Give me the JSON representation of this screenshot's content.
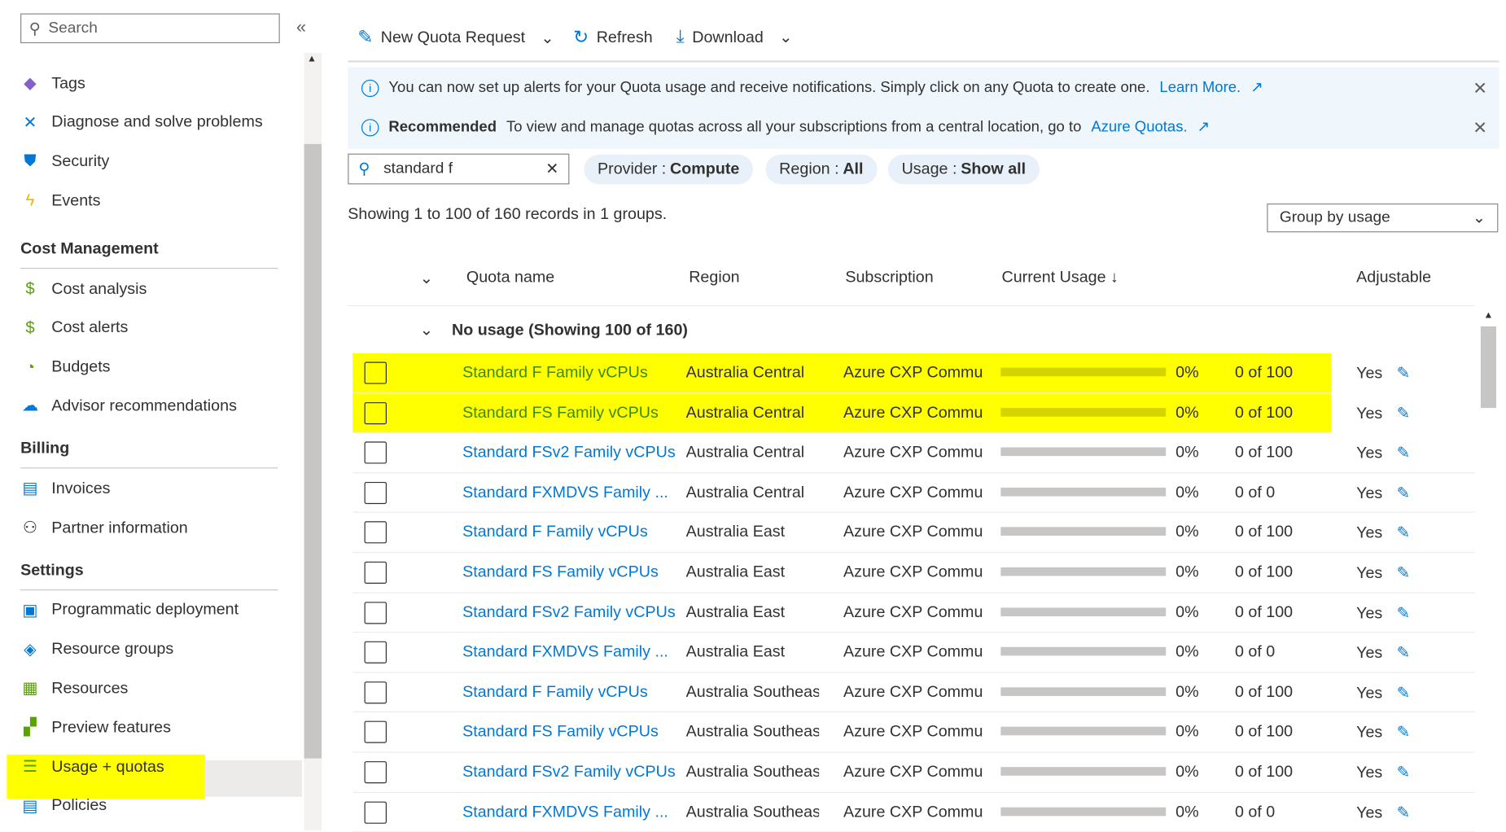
{
  "sidebar": {
    "search_placeholder": "Search",
    "items": [
      {
        "label": "Tags",
        "icon": "tag-icon",
        "color": "#8661c5"
      },
      {
        "label": "Diagnose and solve problems",
        "icon": "wrench-icon",
        "color": "#0078d4"
      },
      {
        "label": "Security",
        "icon": "shield-icon",
        "color": "#0078d4"
      },
      {
        "label": "Events",
        "icon": "lightning-icon",
        "color": "#f8d22a"
      }
    ],
    "sections": [
      {
        "title": "Cost Management",
        "items": [
          {
            "label": "Cost analysis",
            "icon": "cost-analysis-icon"
          },
          {
            "label": "Cost alerts",
            "icon": "cost-alerts-icon"
          },
          {
            "label": "Budgets",
            "icon": "budgets-icon"
          },
          {
            "label": "Advisor recommendations",
            "icon": "advisor-icon"
          }
        ]
      },
      {
        "title": "Billing",
        "items": [
          {
            "label": "Invoices",
            "icon": "invoice-icon"
          },
          {
            "label": "Partner information",
            "icon": "partner-icon"
          }
        ]
      },
      {
        "title": "Settings",
        "items": [
          {
            "label": "Programmatic deployment",
            "icon": "deployment-icon"
          },
          {
            "label": "Resource groups",
            "icon": "resource-groups-icon"
          },
          {
            "label": "Resources",
            "icon": "resources-icon"
          },
          {
            "label": "Preview features",
            "icon": "preview-icon"
          },
          {
            "label": "Usage + quotas",
            "icon": "usage-quotas-icon",
            "selected": true
          },
          {
            "label": "Policies",
            "icon": "policies-icon"
          }
        ]
      }
    ]
  },
  "toolbar": {
    "new_quota": "New Quota Request",
    "refresh": "Refresh",
    "download": "Download"
  },
  "banners": [
    {
      "text": "You can now set up alerts for your Quota usage and receive notifications. Simply click on any Quota to create one.",
      "link": "Learn More."
    },
    {
      "bold": "Recommended",
      "text": "To view and manage quotas across all your subscriptions from a central location, go to",
      "link": "Azure Quotas."
    }
  ],
  "filter": {
    "search_value": "standard f",
    "pills": [
      {
        "label": "Provider :",
        "value": "Compute"
      },
      {
        "label": "Region :",
        "value": "All"
      },
      {
        "label": "Usage :",
        "value": "Show all"
      }
    ]
  },
  "summary": "Showing 1 to 100 of 160 records in 1 groups.",
  "group_by": "Group by usage",
  "columns": [
    "Quota name",
    "Region",
    "Subscription",
    "Current Usage ↓",
    "Adjustable"
  ],
  "group_label": "No usage (Showing 100 of 160)",
  "colors": {
    "highlight": "#ffff00",
    "link": "#0078d4",
    "bar": "#c8c6c4"
  },
  "rows": [
    {
      "name": "Standard F Family vCPUs",
      "region": "Australia Central",
      "sub": "Azure CXP Commu",
      "pct": "0%",
      "usage": "0 of 100",
      "adj": "Yes",
      "highlight": true
    },
    {
      "name": "Standard FS Family vCPUs",
      "region": "Australia Central",
      "sub": "Azure CXP Commu",
      "pct": "0%",
      "usage": "0 of 100",
      "adj": "Yes",
      "highlight": true
    },
    {
      "name": "Standard FSv2 Family vCPUs",
      "region": "Australia Central",
      "sub": "Azure CXP Commu",
      "pct": "0%",
      "usage": "0 of 100",
      "adj": "Yes"
    },
    {
      "name": "Standard FXMDVS Family ...",
      "region": "Australia Central",
      "sub": "Azure CXP Commu",
      "pct": "0%",
      "usage": "0 of 0",
      "adj": "Yes"
    },
    {
      "name": "Standard F Family vCPUs",
      "region": "Australia East",
      "sub": "Azure CXP Commu",
      "pct": "0%",
      "usage": "0 of 100",
      "adj": "Yes"
    },
    {
      "name": "Standard FS Family vCPUs",
      "region": "Australia East",
      "sub": "Azure CXP Commu",
      "pct": "0%",
      "usage": "0 of 100",
      "adj": "Yes"
    },
    {
      "name": "Standard FSv2 Family vCPUs",
      "region": "Australia East",
      "sub": "Azure CXP Commu",
      "pct": "0%",
      "usage": "0 of 100",
      "adj": "Yes"
    },
    {
      "name": "Standard FXMDVS Family ...",
      "region": "Australia East",
      "sub": "Azure CXP Commu",
      "pct": "0%",
      "usage": "0 of 0",
      "adj": "Yes"
    },
    {
      "name": "Standard F Family vCPUs",
      "region": "Australia Southeast",
      "sub": "Azure CXP Commu",
      "pct": "0%",
      "usage": "0 of 100",
      "adj": "Yes"
    },
    {
      "name": "Standard FS Family vCPUs",
      "region": "Australia Southeast",
      "sub": "Azure CXP Commu",
      "pct": "0%",
      "usage": "0 of 100",
      "adj": "Yes"
    },
    {
      "name": "Standard FSv2 Family vCPUs",
      "region": "Australia Southeast",
      "sub": "Azure CXP Commu",
      "pct": "0%",
      "usage": "0 of 100",
      "adj": "Yes"
    },
    {
      "name": "Standard FXMDVS Family ...",
      "region": "Australia Southeast",
      "sub": "Azure CXP Commu",
      "pct": "0%",
      "usage": "0 of 0",
      "adj": "Yes"
    }
  ]
}
